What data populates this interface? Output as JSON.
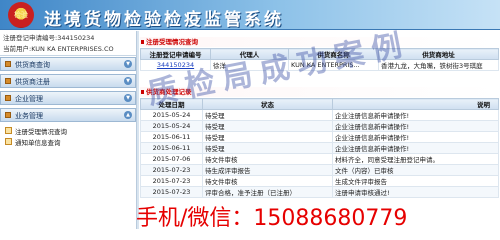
{
  "header": {
    "title": "进境货物检验检疫监管系统",
    "emblem_text": "检验"
  },
  "user_info": {
    "reg_no_label": "注册登记申请编号:",
    "reg_no_value": "344150234",
    "org_label": "当前用户:",
    "org_value": "KUN KA ENTERPRISES.CO"
  },
  "sidebar": {
    "menus": [
      {
        "label": "供货商查询",
        "state": "collapsed"
      },
      {
        "label": "供货商注册",
        "state": "collapsed"
      },
      {
        "label": "企业管理",
        "state": "collapsed"
      },
      {
        "label": "业务管理",
        "state": "expanded"
      }
    ],
    "sub_items": [
      {
        "label": "注册受理情况查询"
      },
      {
        "label": "通知单信息查询"
      }
    ]
  },
  "reg_query": {
    "title": "注册受理情况查询",
    "columns": [
      "注册登记申请编号",
      "代理人",
      "供货商名称",
      "供货商地址"
    ],
    "rows": [
      [
        "344150234",
        "徐洋",
        "KUN KA ENTERPRIS...",
        "香港九龙，大角嘴，铁树街3号琪庭"
      ]
    ]
  },
  "processing": {
    "title": "供货商处理记录",
    "columns": [
      "处理日期",
      "状态",
      "说明"
    ],
    "rows": [
      [
        "2015-05-24",
        "待受理",
        "企业注册信息新申请操作!"
      ],
      [
        "2015-05-24",
        "待受理",
        "企业注册信息新申请操作!"
      ],
      [
        "2015-06-11",
        "待受理",
        "企业注册信息新申请操作!"
      ],
      [
        "2015-06-11",
        "待受理",
        "企业注册信息新申请操作!"
      ],
      [
        "2015-07-06",
        "待文件审核",
        "材料齐全，同意受理注册登记申请。"
      ],
      [
        "2015-07-23",
        "待生成评审报告",
        "文件（内容）已审核"
      ],
      [
        "2015-07-23",
        "待文件审核",
        "生成文件评审报告"
      ],
      [
        "2015-07-23",
        "评审合格，准予注册（已注册）",
        "注册申请审核通过!"
      ]
    ]
  },
  "watermark": {
    "text": "质检局成功案例",
    "contact": "手机/微信：15088680779"
  },
  "colors": {
    "banner_start": "#3f86c7",
    "banner_end": "#c6e2f6",
    "title_red": "#cc0000",
    "contact_red": "#e60000",
    "link_blue": "#1a3fbf"
  }
}
